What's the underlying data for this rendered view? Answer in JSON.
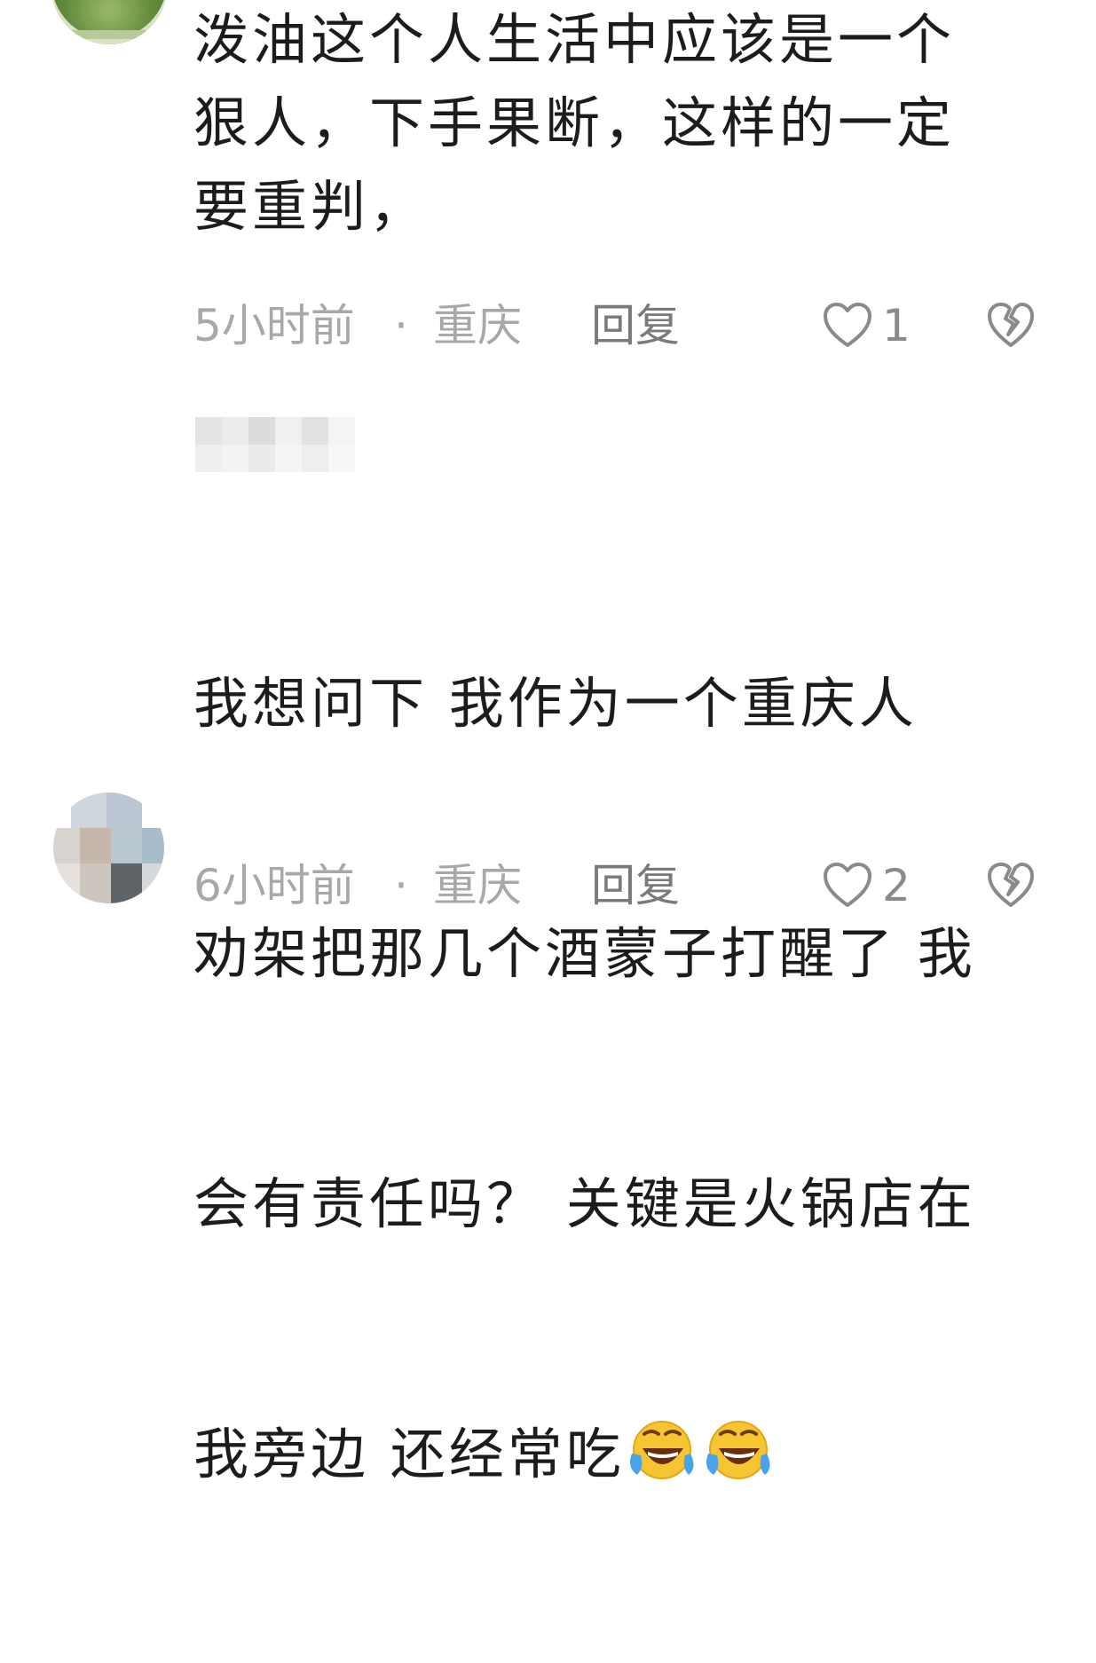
{
  "comments": [
    {
      "text": "泼油这个人生活中应该是一个\n狠人，下手果断，这样的一定\n要重判，",
      "time": "5小时前",
      "dot": "·",
      "location": "重庆",
      "reply_label": "回复",
      "like_count": "1"
    },
    {
      "text_lines": [
        "我想问下 我作为一个重庆人",
        "劝架把那几个酒蒙子打醒了 我",
        "会有责任吗？ 关键是火锅店在",
        "我旁边 还经常吃"
      ],
      "time": "6小时前",
      "dot": "·",
      "location": "重庆",
      "reply_label": "回复",
      "like_count": "2"
    }
  ],
  "icons": {
    "like": "heart-outline-icon",
    "dislike": "broken-heart-icon",
    "emoji": "rolling-on-floor-laughing-emoji"
  },
  "colors": {
    "text": "#1c1c1c",
    "meta": "#a8a8a8",
    "reply": "#7a7a7a",
    "emoji_face": "#f7c531",
    "emoji_tears": "#4aa3e8"
  }
}
